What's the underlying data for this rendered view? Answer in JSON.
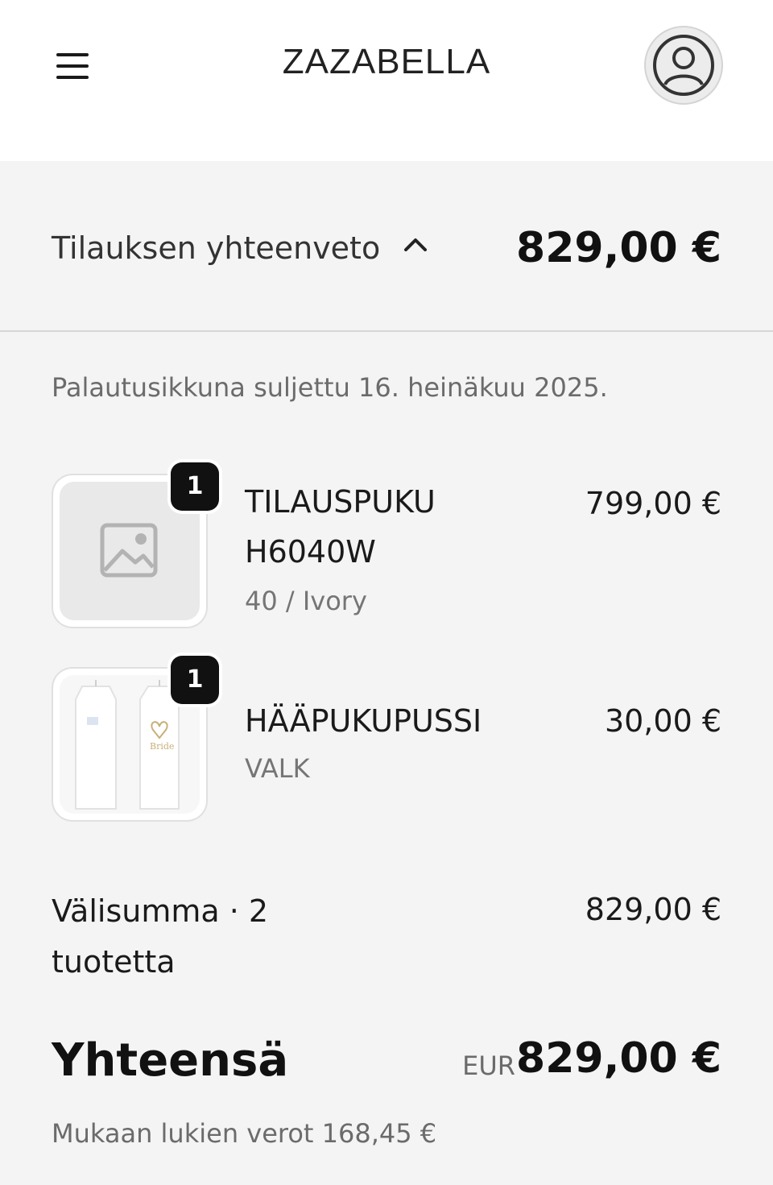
{
  "header": {
    "brand": "ZAZABELLA",
    "menu_icon": "hamburger-menu-icon",
    "account_icon": "user-account-icon"
  },
  "summary": {
    "toggle_label": "Tilauksen yhteenveto",
    "toggle_icon": "chevron-up-icon",
    "total": "829,00 €",
    "return_note": "Palautusikkuna suljettu 16. heinäkuu 2025."
  },
  "items": [
    {
      "quantity": "1",
      "name": "TILAUSPUKU H6040W",
      "variant": "40 / Ivory",
      "price": "799,00 €",
      "thumbnail_icon": "image-placeholder-icon"
    },
    {
      "quantity": "1",
      "name": "HÄÄPUKUPUSSI",
      "variant": "VALK",
      "price": "30,00 €",
      "thumbnail_icon": "garment-bag-photo"
    }
  ],
  "totals": {
    "subtotal_label": "Välisumma · 2 tuotetta",
    "subtotal_value": "829,00 €",
    "total_label": "Yhteensä",
    "currency": "EUR",
    "total_value": "829,00 €",
    "tax_note": "Mukaan lukien verot 168,45 €"
  },
  "colors": {
    "background": "#f4f4f4",
    "header_background": "#ffffff",
    "text": "#1a1a1a",
    "muted_text": "#6b6b6b",
    "badge": "#111111"
  }
}
